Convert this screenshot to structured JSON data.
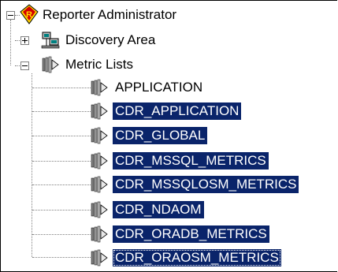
{
  "tree": {
    "root": {
      "label": "Reporter Administrator",
      "icon": "reporter-r-icon",
      "expanded": true
    },
    "children": [
      {
        "label": "Discovery Area",
        "icon": "network-computers-icon",
        "expanded": false
      },
      {
        "label": "Metric Lists",
        "icon": "metric-list-icon",
        "expanded": true
      }
    ],
    "metric_lists": [
      {
        "label": "APPLICATION",
        "selected": false
      },
      {
        "label": "CDR_APPLICATION",
        "selected": true
      },
      {
        "label": "CDR_GLOBAL",
        "selected": true
      },
      {
        "label": "CDR_MSSQL_METRICS",
        "selected": true
      },
      {
        "label": "CDR_MSSQLOSM_METRICS",
        "selected": true
      },
      {
        "label": "CDR_NDAOM",
        "selected": true
      },
      {
        "label": "CDR_ORADB_METRICS",
        "selected": true
      },
      {
        "label": "CDR_ORAOSM_METRICS",
        "selected": true,
        "focused": true
      }
    ],
    "colors": {
      "selection_bg": "#0a246a",
      "selection_text": "#ffffff",
      "tree_lines": "#808080",
      "root_icon_red": "#d40000",
      "root_icon_yellow": "#ffd800"
    }
  }
}
